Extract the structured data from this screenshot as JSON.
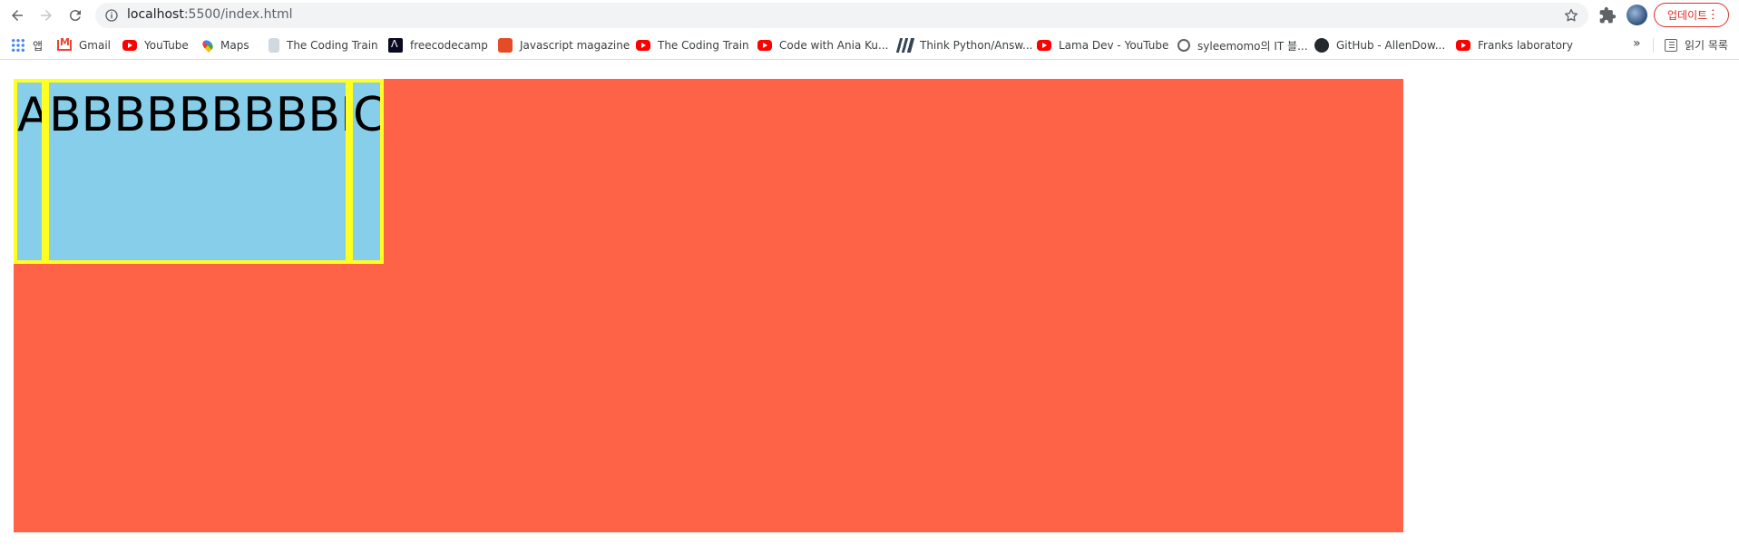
{
  "browser": {
    "url_host": "localhost",
    "url_rest": ":5500/index.html",
    "update_label": "업데이트",
    "colors": {
      "update": "#d93025",
      "omnibox_bg": "#f1f3f4"
    }
  },
  "bookmarks": {
    "items": [
      {
        "label": "앱",
        "icon": "apps-grid-icon"
      },
      {
        "label": "Gmail",
        "icon": "gmail-icon"
      },
      {
        "label": "YouTube",
        "icon": "youtube-icon"
      },
      {
        "label": "Maps",
        "icon": "maps-pin-icon"
      },
      {
        "label": "The Coding Train",
        "icon": "coding-train-icon"
      },
      {
        "label": "freecodecamp",
        "icon": "freecodecamp-icon"
      },
      {
        "label": "Javascript magazine",
        "icon": "js-magazine-icon"
      },
      {
        "label": "The Coding Train",
        "icon": "youtube-icon"
      },
      {
        "label": "Code with Ania Ku...",
        "icon": "youtube-icon"
      },
      {
        "label": "Think Python/Answ...",
        "icon": "think-python-icon"
      },
      {
        "label": "Lama Dev - YouTube",
        "icon": "youtube-icon"
      },
      {
        "label": "syleemomo의 IT 블...",
        "icon": "globe-icon"
      },
      {
        "label": "GitHub - AllenDow...",
        "icon": "github-icon"
      },
      {
        "label": "Franks laboratory",
        "icon": "youtube-icon"
      }
    ],
    "more": "»",
    "reading_list": "읽기 목록"
  },
  "page": {
    "items": [
      {
        "text": "A"
      },
      {
        "text": "BBBBBBBBBB"
      },
      {
        "text": "C"
      }
    ],
    "colors": {
      "container": "#ff6347",
      "item_bg": "#87ceeb",
      "item_border": "#ffff22"
    }
  }
}
